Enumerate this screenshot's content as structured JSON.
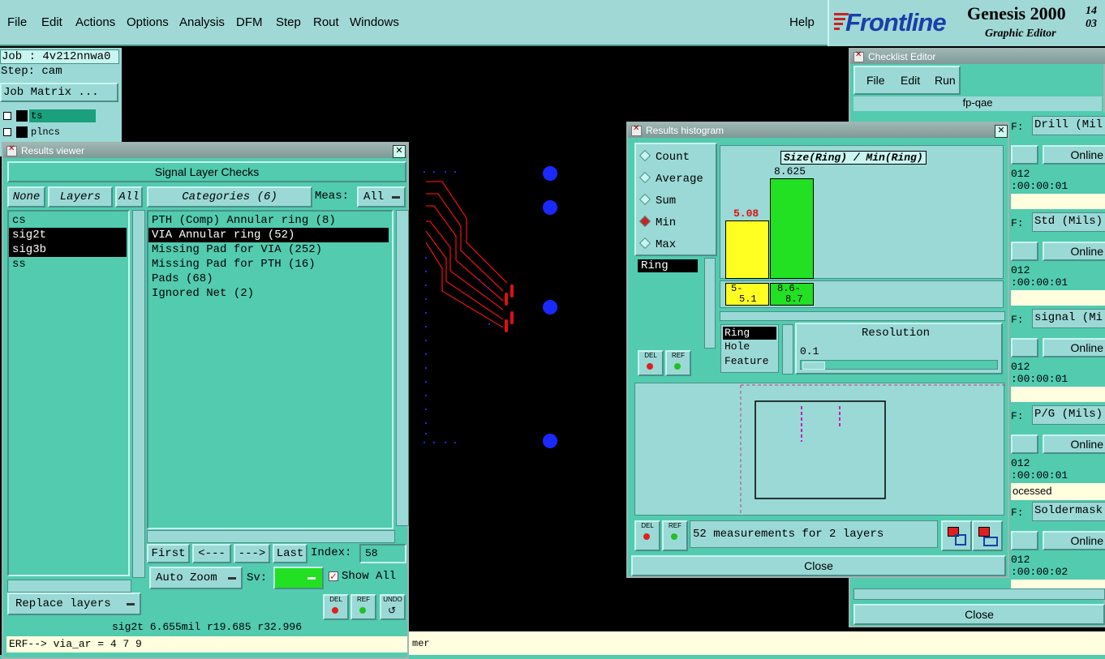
{
  "menubar": {
    "items": [
      "File",
      "Edit",
      "Actions",
      "Options",
      "Analysis",
      "DFM",
      "Step",
      "Rout",
      "Windows"
    ],
    "help": "Help",
    "brand": "Frontline",
    "product": "Genesis 2000",
    "product_sub": "Graphic Editor",
    "clock_top": "14",
    "clock_bottom": "03"
  },
  "job": {
    "job_label": "Job : 4v212nnwa0",
    "step_label": "Step: cam",
    "job_matrix": "Job Matrix ...",
    "layers": [
      "ts",
      "plncs"
    ]
  },
  "results_viewer": {
    "title": "Results viewer",
    "header": "Signal Layer Checks",
    "none_btn": "None",
    "layers_btn": "Layers",
    "all_btn": "All",
    "categories_btn": "Categories (6)",
    "meas_label": "Meas:",
    "meas_value": "All",
    "layer_list": [
      "cs",
      "sig2t",
      "sig3b",
      "ss"
    ],
    "selected_layers": [
      1,
      2
    ],
    "categories": [
      "PTH (Comp) Annular ring (8)",
      "VIA Annular ring (52)",
      "Missing Pad for VIA (252)",
      "Missing Pad for PTH (16)",
      "Pads (68)",
      "Ignored Net (2)"
    ],
    "selected_category": 1,
    "first_btn": "First",
    "prev_btn": "<---",
    "next_btn": "--->",
    "last_btn": "Last",
    "index_label": "Index:",
    "index_value": "58",
    "auto_zoom": "Auto Zoom",
    "sv_label": "Sv:",
    "show_all": "Show All",
    "replace_layers": "Replace layers",
    "del_label": "DEL",
    "ref_label": "REF",
    "undo_label": "UNDO",
    "status_line": "sig2t 6.655mil  r19.685  r32.996",
    "erf_line": "ERF--> via_ar = 4 7 9"
  },
  "results_histogram": {
    "title": "Results histogram",
    "modes": [
      "Count",
      "Average",
      "Sum",
      "Min",
      "Max"
    ],
    "selected_mode": 3,
    "attr_list": [
      "Ring"
    ],
    "chart_title": "Size(Ring) / Min(Ring)",
    "bar1_value": "5.08",
    "bar2_value": "8.625",
    "bin1_label_top": "5-",
    "bin1_label_bottom": "5.1",
    "bin2_label_top": "8.6-",
    "bin2_label_bottom": "8.7",
    "field_list": [
      "Ring",
      "Hole",
      "Feature"
    ],
    "resolution_label": "Resolution",
    "resolution_value": "0.1",
    "measurements": "52 measurements for 2 layers",
    "close": "Close",
    "del_label": "DEL",
    "ref_label": "REF",
    "colors": {
      "bar1": "#ffff22",
      "bar2": "#22e022"
    }
  },
  "checklist": {
    "title": "Checklist Editor",
    "menu": [
      "File",
      "Edit",
      "Run"
    ],
    "name": "fp-qae",
    "rows": [
      {
        "name": "Drill (Mil",
        "btn": "Online",
        "date": "012",
        "time": ":00:00:01"
      },
      {
        "name": "Std (Mils)",
        "btn": "Online",
        "date": "012",
        "time": ":00:00:01"
      },
      {
        "name": "signal (Mi",
        "btn": "Online",
        "date": "012",
        "time": ":00:00:01"
      },
      {
        "name": "P/G (Mils)",
        "btn": "Online",
        "date": "012",
        "time": ":00:00:01"
      },
      {
        "name": "Soldermask",
        "btn": "Online",
        "date": "012",
        "time": ":00:00:02"
      }
    ],
    "f_label": "F:",
    "processed": "ocessed",
    "close": "Close"
  },
  "bottom_bar": {
    "text": "mer"
  }
}
